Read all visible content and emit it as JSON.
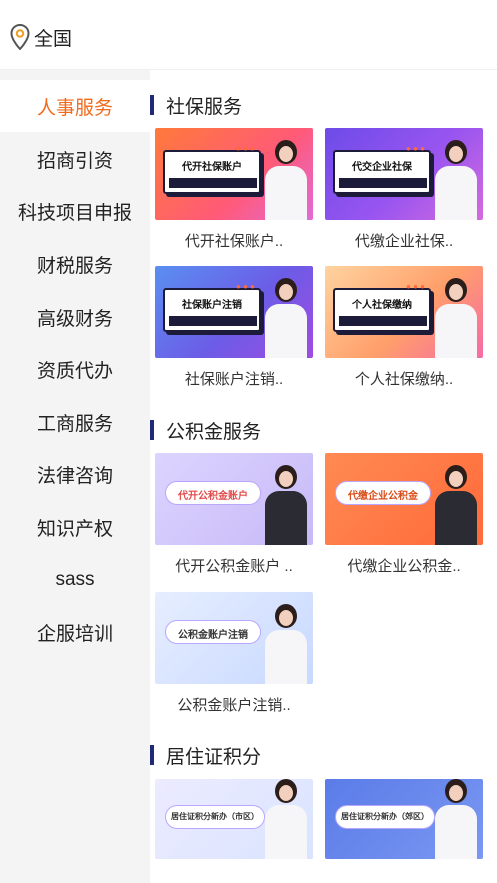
{
  "location": {
    "label": "全国",
    "icon": "location-pin-icon"
  },
  "sidebar": {
    "items": [
      {
        "label": "人事服务",
        "active": true
      },
      {
        "label": "招商引资"
      },
      {
        "label": "科技项目申报"
      },
      {
        "label": "财税服务"
      },
      {
        "label": "高级财务"
      },
      {
        "label": "资质代办"
      },
      {
        "label": "工商服务"
      },
      {
        "label": "法律咨询"
      },
      {
        "label": "知识产权"
      },
      {
        "label": "sass"
      },
      {
        "label": "企服培训"
      }
    ]
  },
  "sections": [
    {
      "title": "社保服务",
      "cards": [
        {
          "banner": "代开社保账户",
          "caption": "代开社保账户.."
        },
        {
          "banner": "代交企业社保",
          "caption": "代缴企业社保.."
        },
        {
          "banner": "社保账户注销",
          "caption": "社保账户注销.."
        },
        {
          "banner": "个人社保缴纳",
          "caption": "个人社保缴纳.."
        }
      ]
    },
    {
      "title": "公积金服务",
      "cards": [
        {
          "banner": "代开公积金账户",
          "caption": "代开公积金账户 .."
        },
        {
          "banner": "代缴企业公积金",
          "caption": "代缴企业公积金.."
        },
        {
          "banner": "公积金账户注销",
          "caption": "公积金账户注销.."
        }
      ]
    },
    {
      "title": "居住证积分",
      "cards": [
        {
          "banner": "居住证积分新办（市区）",
          "caption": ""
        },
        {
          "banner": "居住证积分新办（郊区）",
          "caption": ""
        }
      ]
    }
  ],
  "colors": {
    "accent": "#f26a1b",
    "section_bar": "#1e2a78"
  }
}
